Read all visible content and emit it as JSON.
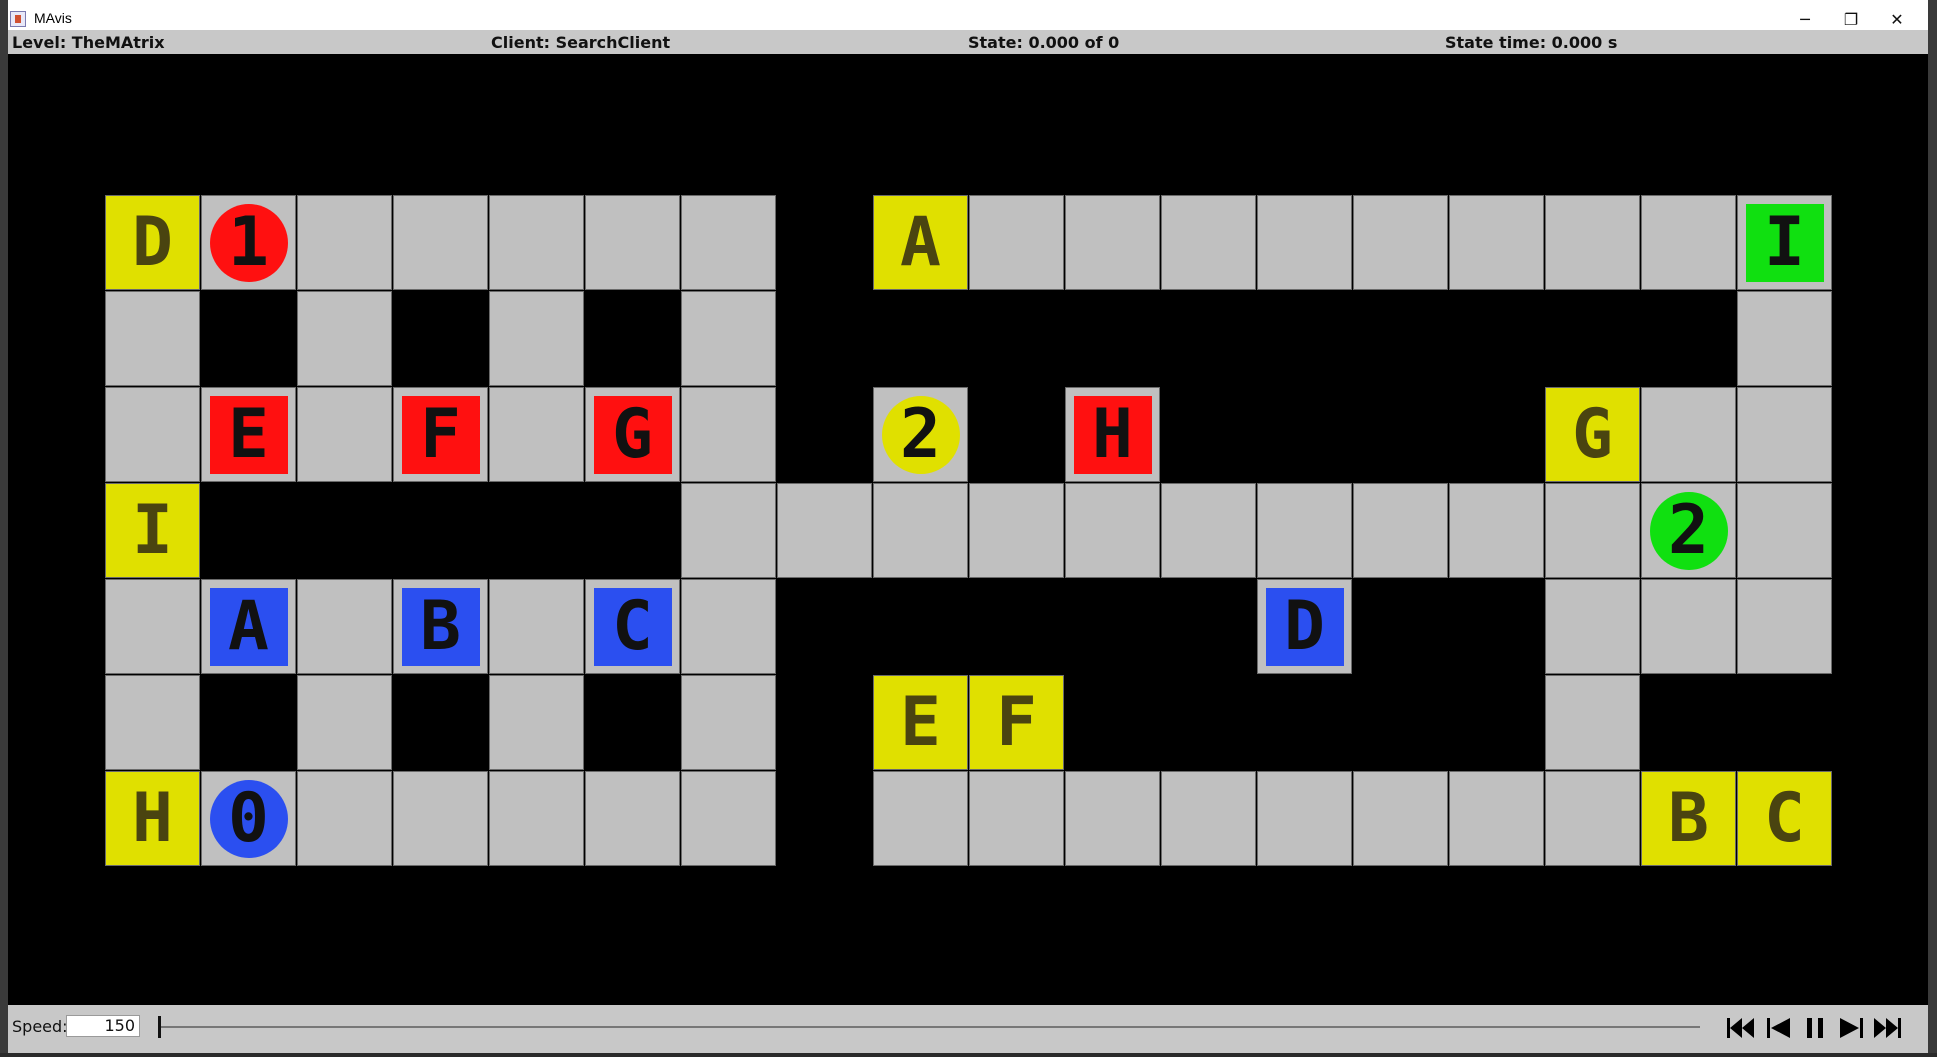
{
  "window": {
    "title": "MAvis",
    "controls": {
      "minimize": "─",
      "restore": "❐",
      "close": "✕"
    }
  },
  "info": {
    "level": "Level: TheMAtrix",
    "client": "Client: SearchClient",
    "state": "State: 0.000 of 0",
    "state_time": "State time: 0.000 s"
  },
  "colors": {
    "floor": "#c0c0c0",
    "wall": "#000000",
    "goal_yellow": "#e0e000",
    "red": "#ff1010",
    "blue": "#2b4ff0",
    "green": "#10e010",
    "yellow": "#e0e000"
  },
  "board": {
    "rows": 7,
    "cols": 18,
    "map": [
      "0000000.0000000000",
      "0000000.1111111110",
      "0000000.0100000000",
      "000000000000000000",
      "0000000.1111111000",
      "0000000.000000000 ",
      "0000000.0000000000"
    ],
    "walls": [
      [
        1,
        1
      ],
      [
        1,
        3
      ],
      [
        1,
        5
      ],
      [
        1,
        8
      ],
      [
        1,
        9
      ],
      [
        1,
        10
      ],
      [
        1,
        11
      ],
      [
        1,
        12
      ],
      [
        1,
        13
      ],
      [
        1,
        14
      ],
      [
        1,
        15
      ],
      [
        1,
        16
      ],
      [
        2,
        9
      ],
      [
        2,
        11
      ],
      [
        2,
        12
      ],
      [
        2,
        13
      ],
      [
        2,
        14
      ],
      [
        3,
        1
      ],
      [
        3,
        2
      ],
      [
        3,
        3
      ],
      [
        3,
        4
      ],
      [
        3,
        5
      ],
      [
        4,
        8
      ],
      [
        4,
        9
      ],
      [
        4,
        10
      ],
      [
        4,
        11
      ],
      [
        4,
        13
      ],
      [
        4,
        14
      ],
      [
        5,
        1
      ],
      [
        5,
        3
      ],
      [
        5,
        5
      ],
      [
        5,
        10
      ],
      [
        5,
        11
      ],
      [
        5,
        12
      ],
      [
        5,
        13
      ],
      [
        5,
        14
      ],
      [
        5,
        16
      ],
      [
        5,
        17
      ],
      [
        0,
        7
      ],
      [
        1,
        7
      ],
      [
        2,
        7
      ],
      [
        4,
        7
      ],
      [
        5,
        7
      ],
      [
        6,
        7
      ]
    ],
    "goals": [
      {
        "row": 0,
        "col": 0,
        "label": "D"
      },
      {
        "row": 0,
        "col": 8,
        "label": "A"
      },
      {
        "row": 2,
        "col": 15,
        "label": "G"
      },
      {
        "row": 3,
        "col": 0,
        "label": "I"
      },
      {
        "row": 5,
        "col": 8,
        "label": "E"
      },
      {
        "row": 5,
        "col": 9,
        "label": "F"
      },
      {
        "row": 6,
        "col": 0,
        "label": "H"
      },
      {
        "row": 6,
        "col": 16,
        "label": "B"
      },
      {
        "row": 6,
        "col": 17,
        "label": "C"
      }
    ],
    "boxes": [
      {
        "row": 0,
        "col": 17,
        "label": "I",
        "color": "green"
      },
      {
        "row": 2,
        "col": 1,
        "label": "E",
        "color": "red"
      },
      {
        "row": 2,
        "col": 3,
        "label": "F",
        "color": "red"
      },
      {
        "row": 2,
        "col": 5,
        "label": "G",
        "color": "red"
      },
      {
        "row": 2,
        "col": 10,
        "label": "H",
        "color": "red"
      },
      {
        "row": 4,
        "col": 1,
        "label": "A",
        "color": "blue"
      },
      {
        "row": 4,
        "col": 3,
        "label": "B",
        "color": "blue"
      },
      {
        "row": 4,
        "col": 5,
        "label": "C",
        "color": "blue"
      },
      {
        "row": 4,
        "col": 12,
        "label": "D",
        "color": "blue"
      }
    ],
    "agents": [
      {
        "row": 0,
        "col": 1,
        "label": "1",
        "color": "red"
      },
      {
        "row": 2,
        "col": 8,
        "label": "2",
        "color": "yellow"
      },
      {
        "row": 3,
        "col": 16,
        "label": "2",
        "color": "green"
      },
      {
        "row": 6,
        "col": 1,
        "label": "0",
        "color": "blue"
      }
    ]
  },
  "controls": {
    "speed_label": "Speed:",
    "speed_value": "150",
    "timeline_progress": 0,
    "buttons": [
      {
        "name": "skip-to-start-button",
        "icon": "skip-start-icon"
      },
      {
        "name": "step-back-button",
        "icon": "step-back-icon"
      },
      {
        "name": "pause-button",
        "icon": "pause-icon"
      },
      {
        "name": "step-forward-button",
        "icon": "step-forward-icon"
      },
      {
        "name": "skip-to-end-button",
        "icon": "skip-end-icon"
      }
    ]
  }
}
